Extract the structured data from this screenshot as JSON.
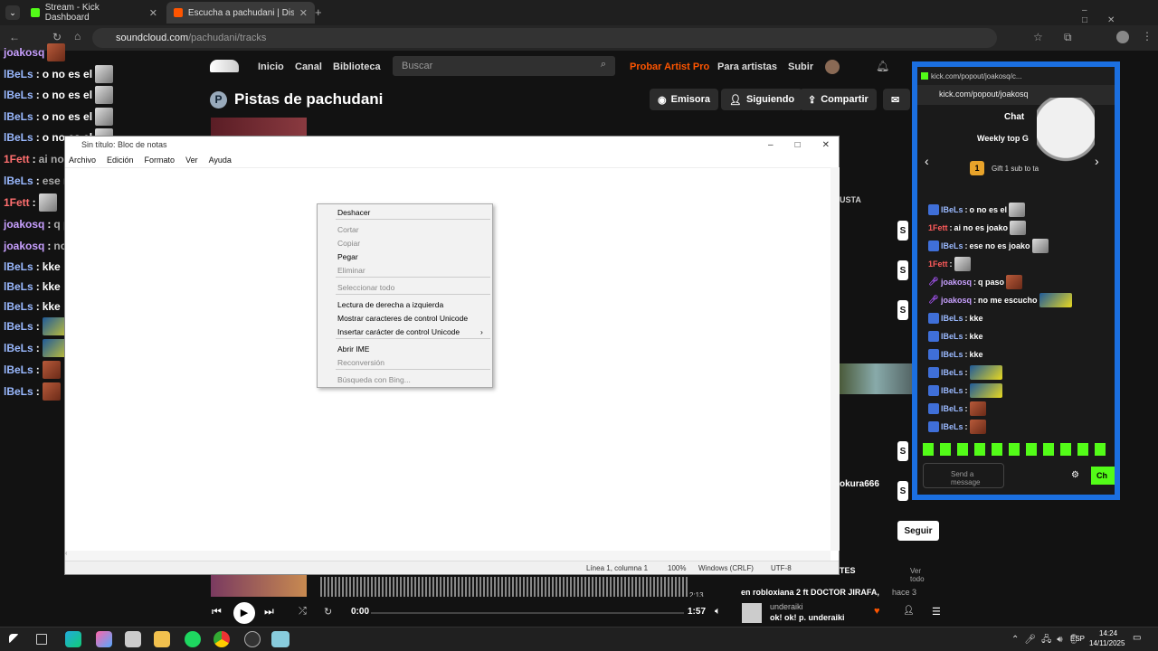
{
  "browser": {
    "tabs": [
      {
        "label": "Stream - Kick Dashboard",
        "icon": "kick-icon"
      },
      {
        "label": "Escucha a pachudani | Disfruta",
        "icon": "soundcloud-icon"
      }
    ],
    "url_host": "soundcloud.com",
    "url_path": "/pachudani/tracks"
  },
  "soundcloud": {
    "nav": {
      "inicio": "Inicio",
      "canal": "Canal",
      "biblioteca": "Biblioteca",
      "search_placeholder": "Buscar",
      "pro": "Probar Artist Pro",
      "artists": "Para artistas",
      "upload": "Subir"
    },
    "title": "Pistas de pachudani",
    "avatar_letter": "P",
    "buttons": {
      "station": "Emisora",
      "following": "Siguiendo",
      "share": "Compartir"
    },
    "sidebar_text": {
      "label1": "USTA",
      "username": "okura666",
      "follow": "Seguir",
      "section": "TES",
      "see_all": "Ver todo",
      "item": "en robloxiana 2 ft DOCTOR JIRAFA,",
      "item_time": "hace 3 días"
    },
    "player": {
      "time_current": "0:00",
      "time_total": "1:57",
      "artist": "underaiki",
      "track": "ok! ok! p. underaiki",
      "wave_end": "2:13"
    }
  },
  "left_chat": [
    {
      "user": "lBeLs",
      "text": "o no es el",
      "emote": "grey"
    },
    {
      "user": "lBeLs",
      "text": "o no es el",
      "emote": "grey"
    },
    {
      "user": "lBeLs",
      "text": "o no es el",
      "emote": "grey"
    },
    {
      "user": "lBeLs",
      "text": "o no es el",
      "emote": "grey"
    },
    {
      "user": "1Fett",
      "text": "ai no es joako",
      "emote": "grey"
    },
    {
      "user": "lBeLs",
      "text": "ese no es joako",
      "emote": "grey"
    },
    {
      "user": "1Fett",
      "text": "",
      "emote": "grey"
    },
    {
      "user": "joakosq",
      "text": "q paso",
      "emote": "red"
    },
    {
      "user": "joakosq",
      "text": "no me escucho",
      "emote": "yellow"
    },
    {
      "user": "lBeLs",
      "text": "kke",
      "emote": ""
    },
    {
      "user": "lBeLs",
      "text": "kke",
      "emote": ""
    },
    {
      "user": "lBeLs",
      "text": "kke",
      "emote": ""
    },
    {
      "user": "lBeLs",
      "text": "",
      "emote": "yellow"
    },
    {
      "user": "lBeLs",
      "text": "",
      "emote": "yellow"
    },
    {
      "user": "lBeLs",
      "text": "",
      "emote": "red"
    },
    {
      "user": "lBeLs",
      "text": "",
      "emote": "red"
    }
  ],
  "left_chat_top": {
    "user": "joakosq",
    "text": "o no es el"
  },
  "notepad": {
    "title": "Sin título: Bloc de notas",
    "menu": [
      "Archivo",
      "Edición",
      "Formato",
      "Ver",
      "Ayuda"
    ],
    "status": {
      "pos": "Línea 1, columna 1",
      "zoom": "100%",
      "eol": "Windows (CRLF)",
      "enc": "UTF-8"
    }
  },
  "context_menu": [
    {
      "label": "Deshacer",
      "enabled": true
    },
    {
      "label": "Cortar",
      "enabled": false
    },
    {
      "label": "Copiar",
      "enabled": false
    },
    {
      "label": "Pegar",
      "enabled": true
    },
    {
      "label": "Eliminar",
      "enabled": false
    },
    {
      "label": "Seleccionar todo",
      "enabled": false
    },
    {
      "label": "Lectura de derecha a izquierda",
      "enabled": true
    },
    {
      "label": "Mostrar caracteres de control Unicode",
      "enabled": true
    },
    {
      "label": "Insertar carácter de control Unicode",
      "enabled": true
    },
    {
      "label": "Abrir IME",
      "enabled": true
    },
    {
      "label": "Reconversión",
      "enabled": false
    },
    {
      "label": "Búsqueda con Bing...",
      "enabled": false
    }
  ],
  "kick": {
    "window_title": "kick.com/popout/joakosq/c...",
    "url": "kick.com/popout/joakosq",
    "header": "Chat",
    "weekly": "Weekly top G",
    "gift": "Gift 1 sub to ta",
    "gift_count": "1",
    "messages": [
      {
        "user": "lBeLs",
        "text": "o no es el",
        "color": "blue"
      },
      {
        "user": "1Fett",
        "text": "ai no es joako",
        "color": "red"
      },
      {
        "user": "lBeLs",
        "text": "ese no es joako",
        "color": "blue"
      },
      {
        "user": "1Fett",
        "text": "",
        "color": "red"
      },
      {
        "user": "joakosq",
        "text": "q paso",
        "color": "pur"
      },
      {
        "user": "joakosq",
        "text": "no me escucho",
        "color": "pur"
      },
      {
        "user": "lBeLs",
        "text": "kke",
        "color": "blue"
      },
      {
        "user": "lBeLs",
        "text": "kke",
        "color": "blue"
      },
      {
        "user": "lBeLs",
        "text": "kke",
        "color": "blue"
      },
      {
        "user": "lBeLs",
        "text": "",
        "color": "blue"
      },
      {
        "user": "lBeLs",
        "text": "",
        "color": "blue"
      },
      {
        "user": "lBeLs",
        "text": "",
        "color": "blue"
      },
      {
        "user": "lBeLs",
        "text": "",
        "color": "blue"
      }
    ],
    "input_placeholder": "Send a message",
    "send": "Ch"
  },
  "taskbar": {
    "lang": "ESP",
    "time": "14:24",
    "date": "14/11/2025"
  },
  "colors": {
    "accent_kick": "#53fc18",
    "soundcloud_orange": "#ff5500",
    "kick_border": "#1b6fe0"
  }
}
